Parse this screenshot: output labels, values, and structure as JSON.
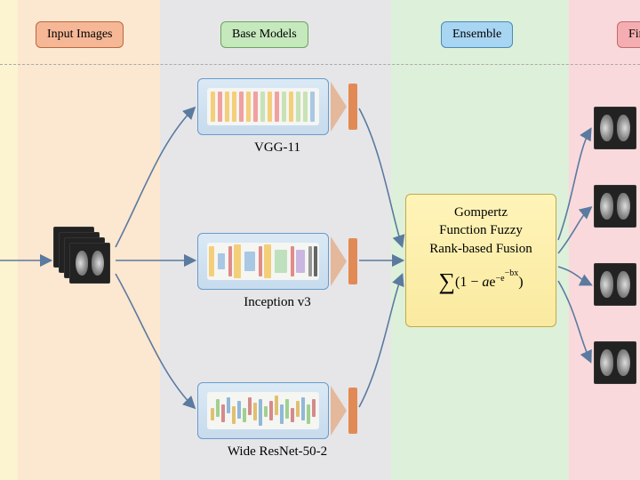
{
  "stages": {
    "input": "Input Images",
    "base": "Base Models",
    "ensemble": "Ensemble",
    "final": "Final P"
  },
  "models": {
    "m1": "VGG-11",
    "m2": "Inception v3",
    "m3": "Wide ResNet-50-2"
  },
  "fusion": {
    "l1": "Gompertz",
    "l2": "Function Fuzzy",
    "l3": "Rank-based Fusion",
    "formula_tex": "\\sum (1 - a e^{-e^{-bx}})"
  },
  "diagram": {
    "type": "architecture-flow",
    "flow": [
      "Input Images",
      "Base Models (VGG-11, Inception v3, Wide ResNet-50-2)",
      "Ensemble (Gompertz Function Fuzzy Rank-based Fusion)",
      "Final"
    ],
    "stage_colors": {
      "input": "#fce7d0",
      "base": "#e6e6e8",
      "ensemble": "#ddf0d9",
      "final": "#f9d9dc"
    }
  }
}
